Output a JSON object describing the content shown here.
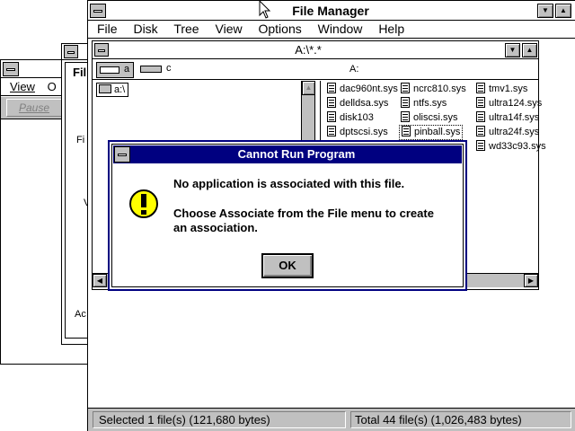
{
  "background_windows": {
    "left_window": {
      "menu_view": "View",
      "menu_o": "O",
      "pause_button": "Pause"
    },
    "middle_window": {
      "title_fragment": "Fil",
      "side_text_1": "Fi",
      "side_text_2": "V",
      "side_text_3": "Ac"
    }
  },
  "file_manager": {
    "title": "File Manager",
    "menus": [
      "File",
      "Disk",
      "Tree",
      "View",
      "Options",
      "Window",
      "Help"
    ],
    "child": {
      "title": "A:\\*.*",
      "drives": [
        "a",
        "c"
      ],
      "drive_label": "A:",
      "tree_root": "a:\\",
      "files": [
        "dac960nt.sys",
        "ncrc810.sys",
        "tmv1.sys",
        "delldsa.sys",
        "ntfs.sys",
        "ultra124.sys",
        "disk103",
        "oliscsi.sys",
        "ultra14f.sys",
        "dptscsi.sys",
        "pinball.sys",
        "ultra24f.sys",
        "wd33c93.sys"
      ],
      "selected_file": "pinball.sys"
    },
    "status_left": "Selected 1 file(s) (121,680 bytes)",
    "status_right": "Total 44 file(s) (1,026,483 bytes)"
  },
  "dialog": {
    "title": "Cannot Run Program",
    "message_1": "No application is associated with this file.",
    "message_2_line_1": "Choose Associate from the File menu to create",
    "message_2_line_2": "an association.",
    "ok_label": "OK",
    "icon": "exclamation-icon"
  },
  "colors": {
    "title_active": "#000080",
    "window_face": "#c0c0c0",
    "desktop": "#ffffff"
  }
}
